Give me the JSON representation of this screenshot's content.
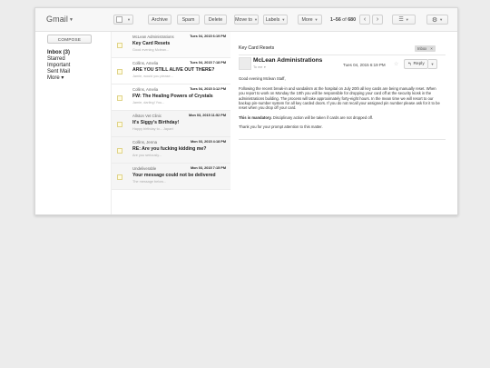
{
  "app": {
    "logo": "Gmail"
  },
  "toolbar": {
    "archive": "Archive",
    "spam": "Spam",
    "delete": "Delete",
    "move_to": "Move to",
    "labels": "Labels",
    "more": "More",
    "pager_range": "1–56",
    "pager_of": "of",
    "pager_total": "680",
    "prev_icon": "‹",
    "next_icon": "›",
    "settings_icon": "⚙"
  },
  "nav": {
    "compose": "COMPOSE",
    "items": [
      {
        "label": "Inbox (3)"
      },
      {
        "label": "Starred"
      },
      {
        "label": "Important"
      },
      {
        "label": "Sent Mail"
      },
      {
        "label": "More ▾"
      }
    ]
  },
  "messages": [
    {
      "sender": "McLean Administrations",
      "date": "Tues 04, 2015 6:19 PM",
      "subject": "Key Card Resets",
      "snippet": "Good evening Mclean..."
    },
    {
      "sender": "Collins, Amelia",
      "date": "Tues 04, 2015 7:18 PM",
      "subject": "ARE YOU STILL ALIVE OUT THERE?",
      "snippet": "Jamie, would you please..."
    },
    {
      "sender": "Collins, Amelia",
      "date": "Tues 04, 2015 3:12 PM",
      "subject": "FW: The Healing Powers of Crystals",
      "snippet": "Jamie, darling! You..."
    },
    {
      "sender": "Allston Vet Clinic",
      "date": "Mon 03, 2015 11:52 PM",
      "subject": "It's Siggy's Birthday!",
      "snippet": "Happy birthday to... Japan!"
    },
    {
      "sender": "Collins, Jenna",
      "date": "Mon 03, 2015 4:18 PM",
      "subject": "RE: Are you fucking kidding me?",
      "snippet": "Are you seriously..."
    },
    {
      "sender": "Undeliverable",
      "date": "Mon 03, 2015 7:15 PM",
      "subject": "Your message could not be delivered",
      "snippet": "The message below..."
    }
  ],
  "reading": {
    "subject": "Key Card Resets",
    "label_badge": "Inbox",
    "from": "McLean Administrations",
    "to": "To me",
    "date": "Tues 04, 2015 6:19 PM",
    "reply": "Reply",
    "greeting": "Good evening Mclean Staff,",
    "paragraph": "Following the recent break-in and vandalism at the hospital on July 20th all key cards are being manually reset. When you report to work on Monday the 10th you will be responsible for dropping your card off at the security kiosk in the administrations building. The process will take approximately forty-eight hours. In the mean time we will resort to our backup pin-number system for all key carded doors. If you do not recall your assigned pin number please ask for it to be reset when you drop off your card.",
    "mandatory_bold": "This is mandatory.",
    "mandatory_rest": " Disciplinary action will be taken if cards are not dropped off.",
    "thanks": "Thank you for your prompt attention to this matter."
  }
}
